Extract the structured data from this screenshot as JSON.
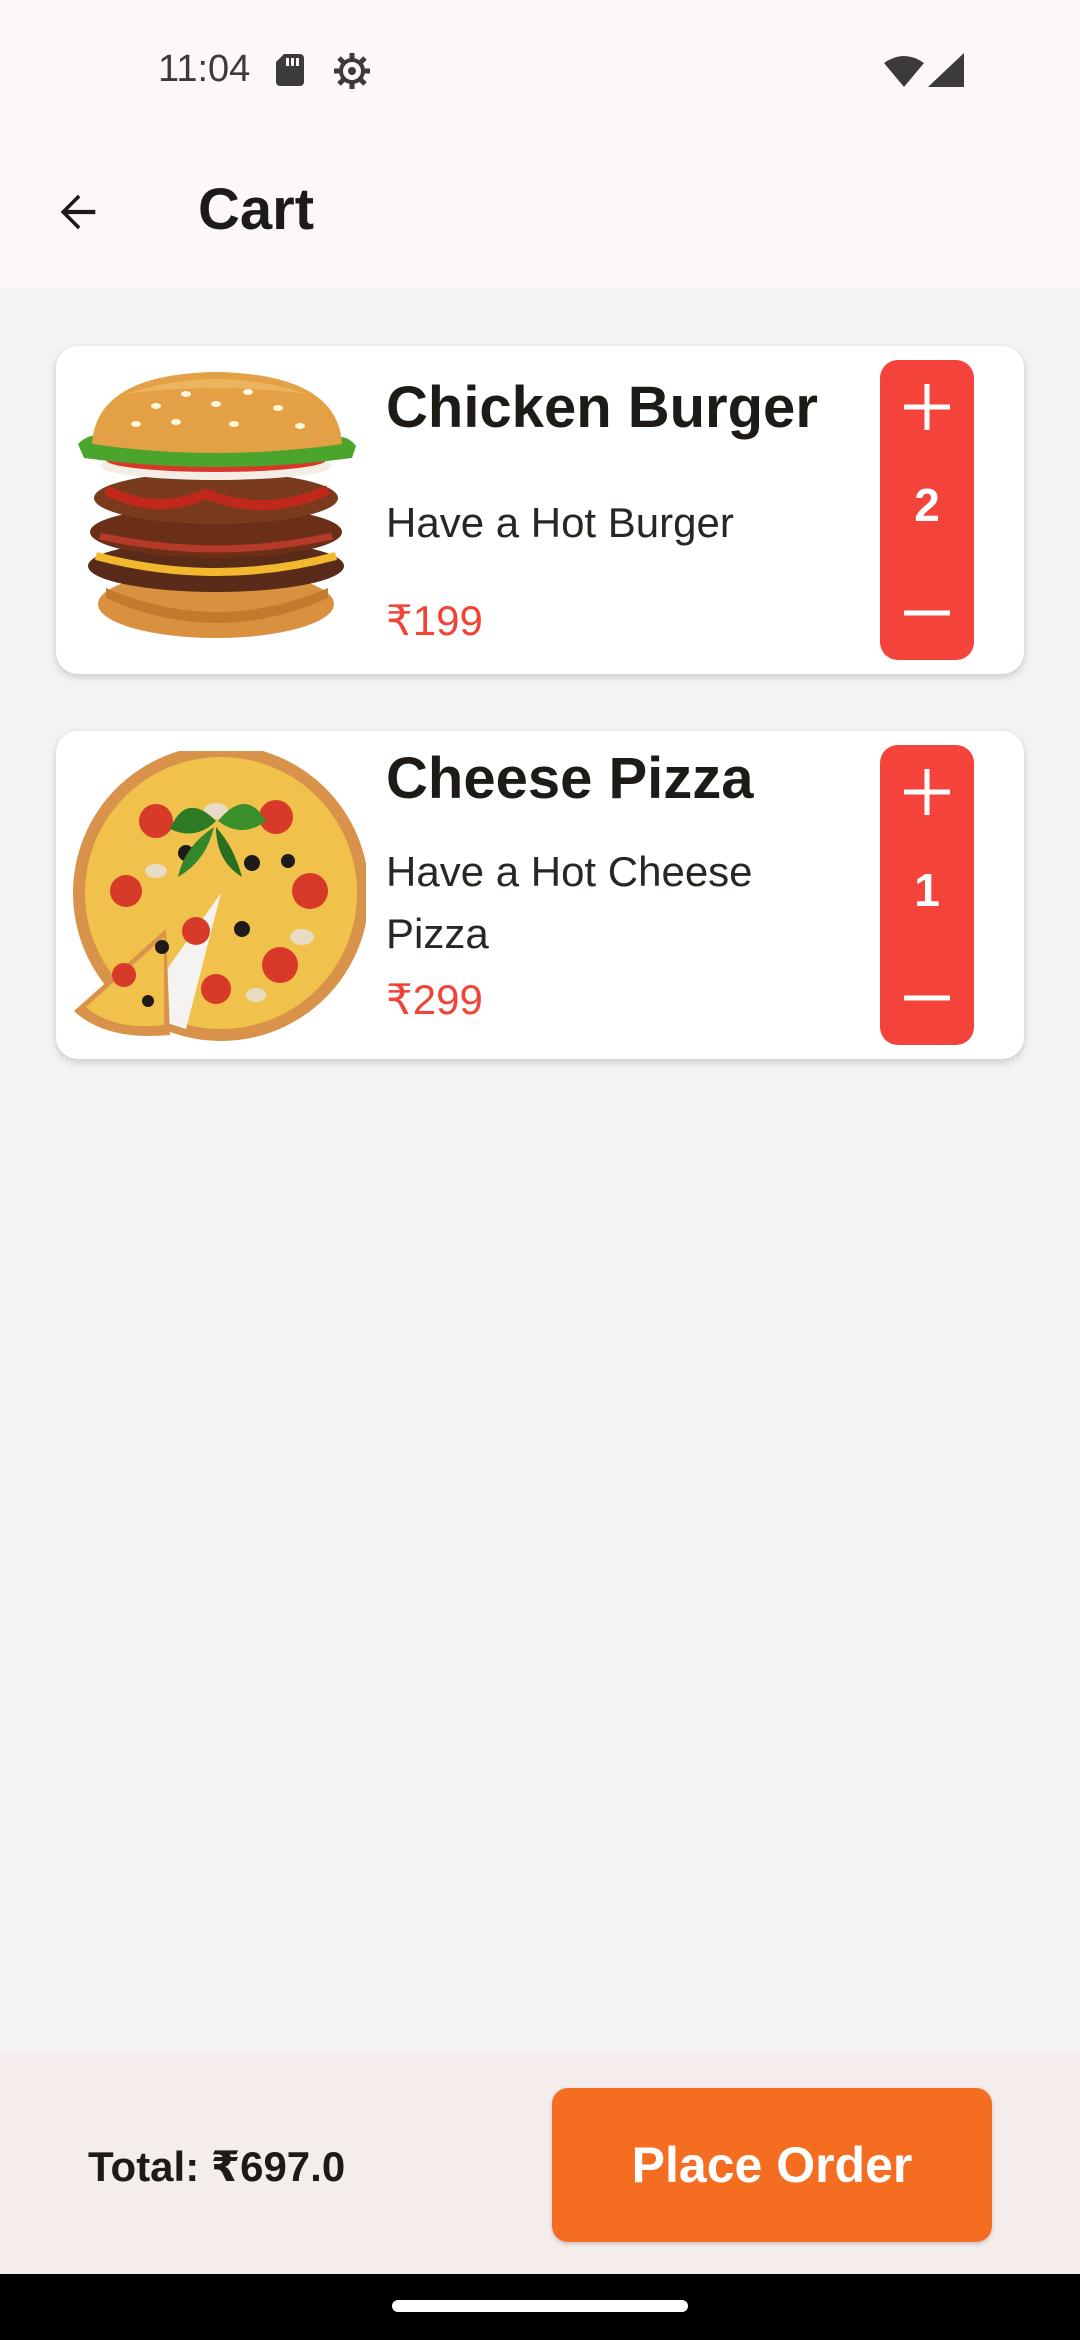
{
  "status_bar": {
    "time": "11:04",
    "icons": [
      "sd-card-icon",
      "gear-icon",
      "wifi-icon",
      "cellular-signal-icon"
    ]
  },
  "app_bar": {
    "title": "Cart",
    "back_icon": "arrow-back-icon"
  },
  "cart": {
    "items": [
      {
        "name": "Chicken Burger",
        "description": "Have a Hot Burger",
        "price": "₹199",
        "quantity": "2",
        "image": "burger-image"
      },
      {
        "name": "Cheese Pizza",
        "description": "Have a Hot Cheese Pizza",
        "price": "₹299",
        "quantity": "1",
        "image": "pizza-image"
      }
    ]
  },
  "footer": {
    "total": "Total: ₹697.0",
    "place_order_label": "Place Order"
  },
  "colors": {
    "accent_red": "#F4433A",
    "price_red": "#F04438",
    "order_orange": "#F56D20",
    "header_bg": "#FDF7FB",
    "page_bg": "#F4F3F2"
  }
}
